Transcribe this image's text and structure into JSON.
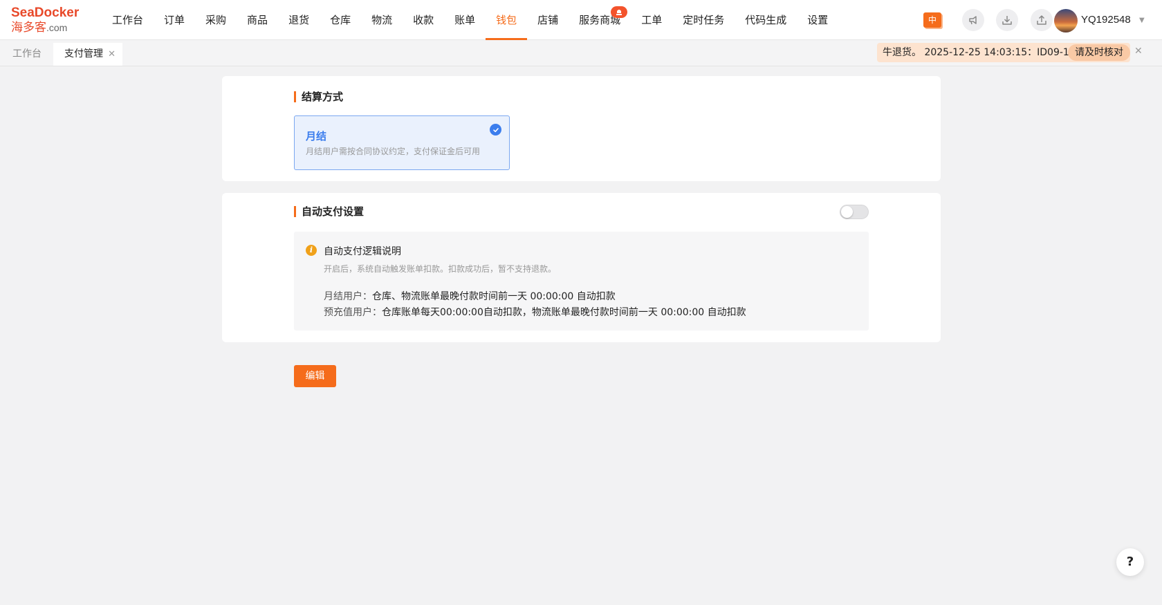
{
  "brand": {
    "name_en": "SeaDocker",
    "name_cn": "海多客",
    "domain": ".com",
    "color": "#e8492a"
  },
  "nav": {
    "items": [
      {
        "label": "工作台"
      },
      {
        "label": "订单"
      },
      {
        "label": "采购"
      },
      {
        "label": "商品"
      },
      {
        "label": "退货"
      },
      {
        "label": "仓库"
      },
      {
        "label": "物流"
      },
      {
        "label": "收款"
      },
      {
        "label": "账单"
      },
      {
        "label": "钱包",
        "active": true
      },
      {
        "label": "店铺"
      },
      {
        "label": "服务商城",
        "badge": ""
      },
      {
        "label": "工单"
      },
      {
        "label": "定时任务"
      },
      {
        "label": "代码生成"
      },
      {
        "label": "设置"
      }
    ],
    "accent": "#f56c1b"
  },
  "header_right": {
    "lang_label": "中",
    "icons": [
      "megaphone-icon",
      "download-icon",
      "share-icon"
    ],
    "username": "YQ192548"
  },
  "tabs": [
    {
      "label": "工作台",
      "active": false
    },
    {
      "label": "支付管理",
      "active": true
    }
  ],
  "notice": {
    "text": "牛退货。 2025-12-25 14:03:15：ID09-1115",
    "action": "请及时核对"
  },
  "settlement": {
    "title": "结算方式",
    "option": {
      "name": "月结",
      "desc": "月结用户需按合同协议约定，支付保证金后可用",
      "selected": true
    }
  },
  "auto_pay": {
    "title": "自动支付设置",
    "enabled": false,
    "info": {
      "title": "自动支付逻辑说明",
      "subtitle": "开启后，系统自动触发账单扣款。扣款成功后，暂不支持退款。",
      "lines": [
        {
          "label": "月结用户：",
          "value": "仓库、物流账单最晚付款时间前一天 00:00:00 自动扣款"
        },
        {
          "label": "预充值用户：",
          "value": "仓库账单每天00:00:00自动扣款，物流账单最晚付款时间前一天 00:00:00 自动扣款"
        }
      ]
    }
  },
  "actions": {
    "edit_label": "编辑"
  },
  "help": {
    "label": "?"
  }
}
